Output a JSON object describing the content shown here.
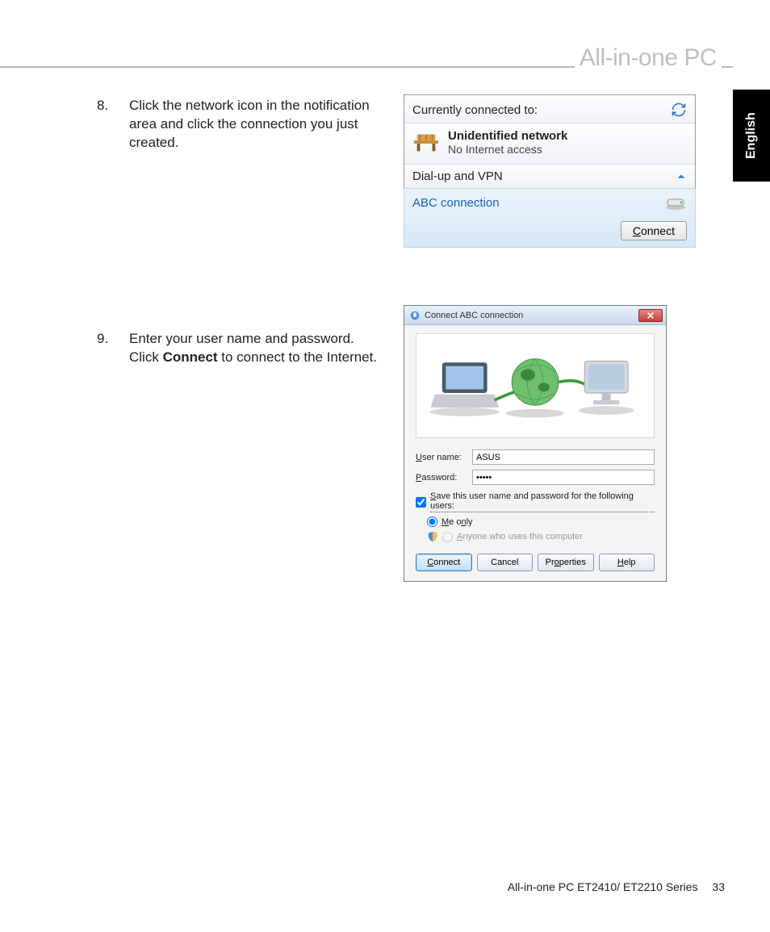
{
  "header": {
    "title": "All-in-one PC"
  },
  "lang_tab": "English",
  "steps": {
    "s1": {
      "num": "8.",
      "text": "Click the network icon in the notification area and click the connection you just created."
    },
    "s2": {
      "num": "9.",
      "text_before": "Enter your user name and password. Click ",
      "bold": "Connect",
      "text_after": " to connect to the Internet."
    }
  },
  "netpopup": {
    "heading": "Currently connected to:",
    "network": {
      "title": "Unidentified network",
      "sub": "No Internet access"
    },
    "section": "Dial-up and VPN",
    "connection": "ABC connection",
    "connect_btn": "Connect"
  },
  "dialog": {
    "title": "Connect ABC connection",
    "username_label": "User name:",
    "username_value": "ASUS",
    "password_label": "Password:",
    "password_value": "•••••",
    "save_chk": "Save this user name and password for the following users:",
    "radio_me": "Me only",
    "radio_anyone": "Anyone who uses this computer",
    "buttons": {
      "connect": "Connect",
      "cancel": "Cancel",
      "properties": "Properties",
      "help": "Help"
    }
  },
  "footer": {
    "text": "All-in-one PC ET2410/ ET2210 Series",
    "page": "33"
  },
  "chk_u": "U",
  "chk_p": "P",
  "chk_s": "S",
  "chk_m": "M",
  "chk_a": "A",
  "chk_c": "C",
  "chk_o": "o",
  "chk_h": "H"
}
